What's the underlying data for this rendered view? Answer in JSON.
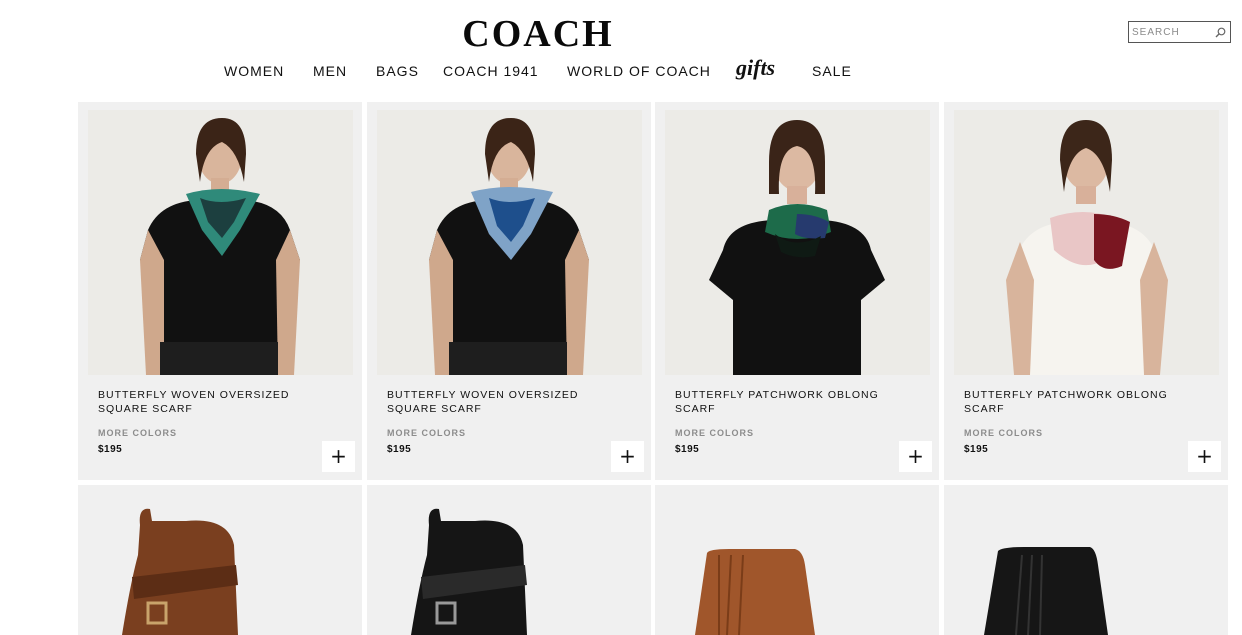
{
  "header": {
    "logo": "COACH",
    "search": {
      "placeholder": "SEARCH"
    }
  },
  "nav": {
    "items": [
      {
        "label": "WOMEN"
      },
      {
        "label": "MEN"
      },
      {
        "label": "BAGS"
      },
      {
        "label": "COACH 1941"
      },
      {
        "label": "WORLD OF COACH"
      },
      {
        "label": "gifts"
      },
      {
        "label": "SALE"
      }
    ]
  },
  "products": [
    {
      "name": "BUTTERFLY WOVEN OVERSIZED SQUARE SCARF",
      "more_colors": "MORE COLORS",
      "price": "$195",
      "add": "+",
      "scarf_colors": [
        "#2f8a7a",
        "#1c3f3f"
      ],
      "top": "black"
    },
    {
      "name": "BUTTERFLY WOVEN OVERSIZED SQUARE SCARF",
      "more_colors": "MORE COLORS",
      "price": "$195",
      "add": "+",
      "scarf_colors": [
        "#7fa3c7",
        "#1e4f8c"
      ],
      "top": "black"
    },
    {
      "name": "BUTTERFLY PATCHWORK OBLONG SCARF",
      "more_colors": "MORE COLORS",
      "price": "$195",
      "add": "+",
      "scarf_colors": [
        "#1d6b4a",
        "#263a6e"
      ],
      "top": "black"
    },
    {
      "name": "BUTTERFLY PATCHWORK OBLONG SCARF",
      "more_colors": "MORE COLORS",
      "price": "$195",
      "add": "+",
      "scarf_colors": [
        "#e9c6c6",
        "#7a1621"
      ],
      "top": "white"
    }
  ],
  "boots": [
    {
      "color": "#7a3f1f"
    },
    {
      "color": "#151515"
    },
    {
      "color": "#a0562b"
    },
    {
      "color": "#161616"
    }
  ]
}
